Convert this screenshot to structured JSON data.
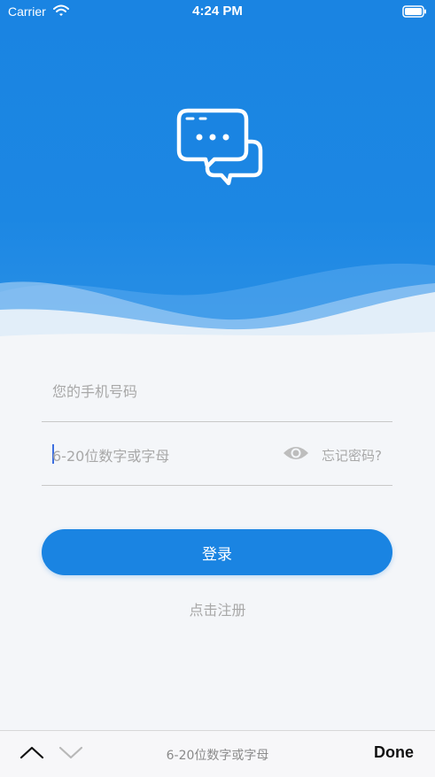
{
  "status_bar": {
    "carrier": "Carrier",
    "time": "4:24 PM",
    "wifi_icon": "wifi-icon",
    "battery_icon": "battery-icon"
  },
  "header": {
    "logo_icon": "chat-bubbles-icon",
    "background_color": "#1a84e2"
  },
  "form": {
    "phone_placeholder": "您的手机号码",
    "password_placeholder": "6-20位数字或字母",
    "eye_icon": "eye-icon",
    "forgot_label": "忘记密码?",
    "login_label": "登录",
    "register_label": "点击注册"
  },
  "keyboard_toolbar": {
    "up_icon": "chevron-up-icon",
    "down_icon": "chevron-down-icon",
    "hint": "6-20位数字或字母",
    "done_label": "Done"
  },
  "colors": {
    "accent": "#1a84e2",
    "placeholder": "#a8a8a8",
    "background": "#f4f6f9"
  }
}
